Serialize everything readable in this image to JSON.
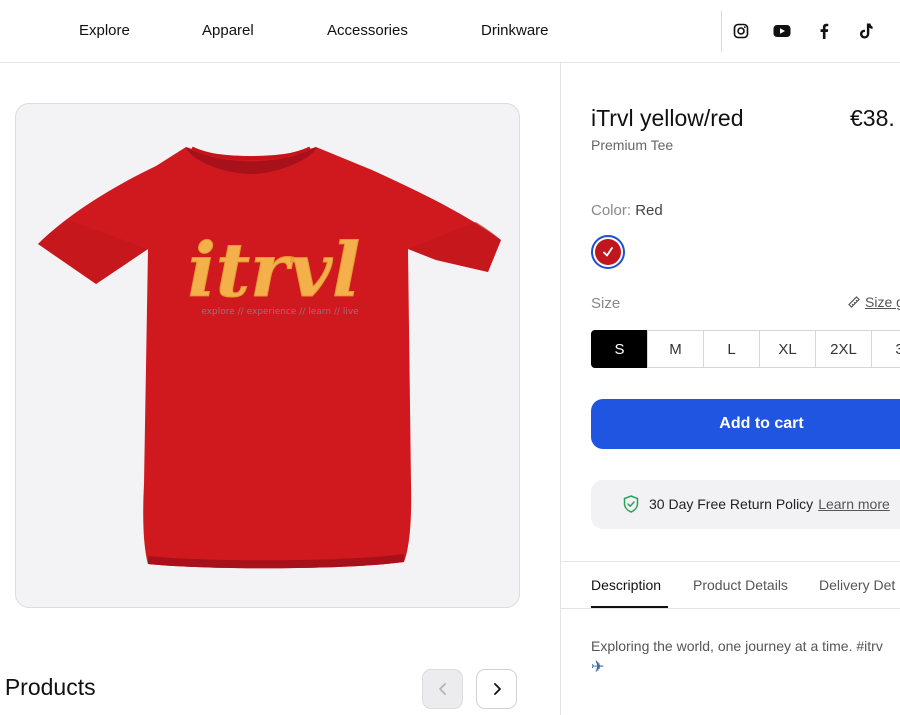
{
  "nav": {
    "links": [
      "Explore",
      "Apparel",
      "Accessories",
      "Drinkware"
    ],
    "social": [
      "instagram-icon",
      "youtube-icon",
      "facebook-icon",
      "tiktok-icon"
    ]
  },
  "product": {
    "image_alt": "iTrvl red t-shirt",
    "shirt_logo": "itrvl",
    "shirt_tagline": "explore // experience // learn // live",
    "title": "iTrvl yellow/red",
    "price": "€38.",
    "subtitle": "Premium Tee",
    "color_label": "Color:",
    "color_value": "Red",
    "swatch_color": "#c1161d",
    "size_label": "Size",
    "size_guide": "Size g",
    "sizes": [
      "S",
      "M",
      "L",
      "XL",
      "2XL",
      "3"
    ],
    "selected_size": "S",
    "add_to_cart": "Add to cart",
    "return_policy": "30 Day Free Return Policy",
    "learn_more": "Learn more",
    "tabs": [
      "Description",
      "Product Details",
      "Delivery Det"
    ],
    "description": "Exploring the world, one journey at a time. #itrv"
  },
  "section": {
    "title": "ar Products"
  },
  "colors": {
    "accent": "#1f55e0",
    "shirt": "#d0191f",
    "logo": "#f4b04a"
  }
}
